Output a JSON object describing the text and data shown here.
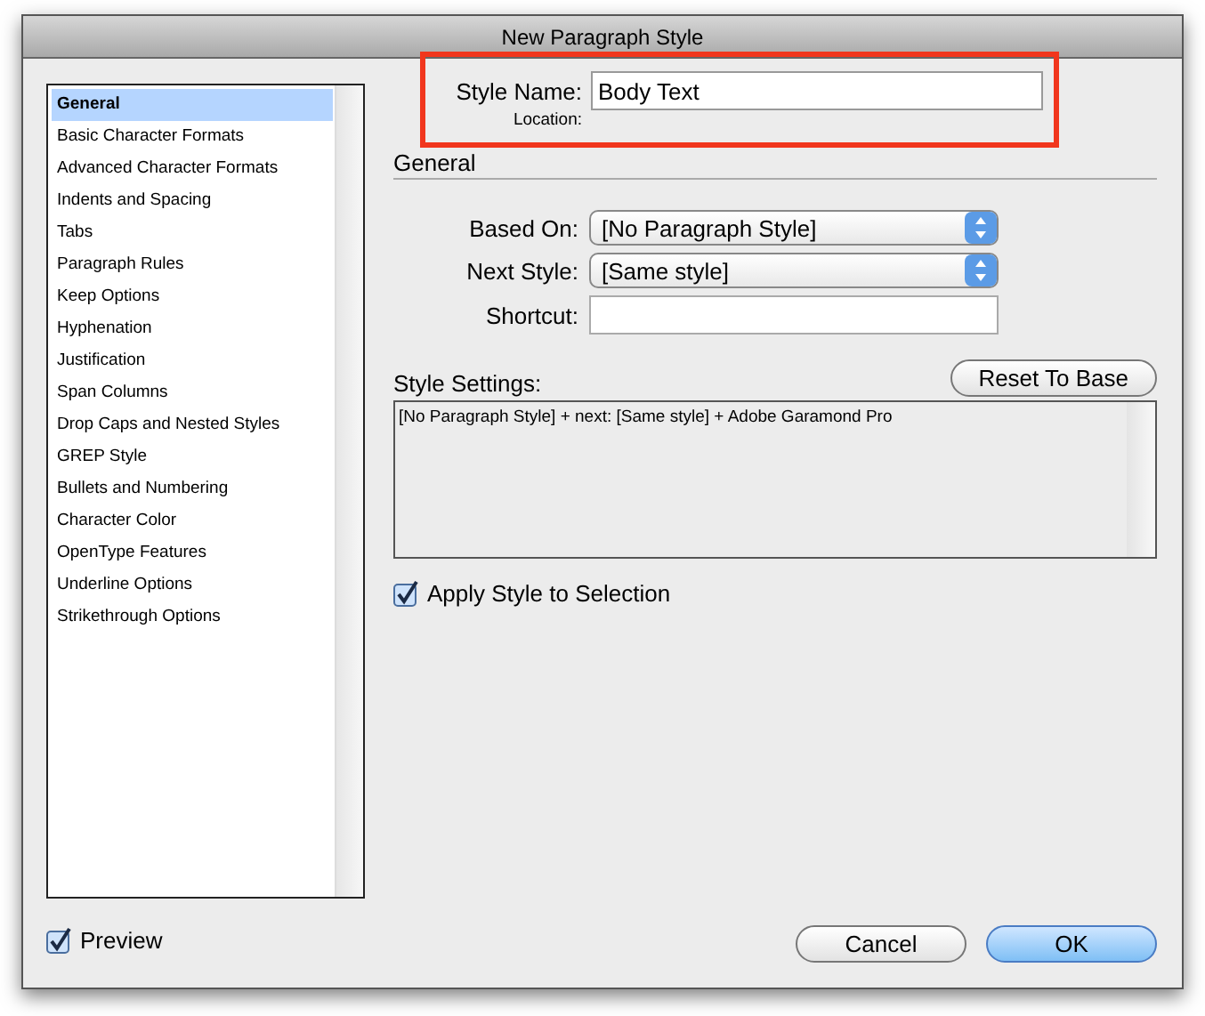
{
  "window": {
    "title": "New Paragraph Style"
  },
  "categories": [
    {
      "label": "General",
      "selected": true
    },
    {
      "label": "Basic Character Formats",
      "selected": false
    },
    {
      "label": "Advanced Character Formats",
      "selected": false
    },
    {
      "label": "Indents and Spacing",
      "selected": false
    },
    {
      "label": "Tabs",
      "selected": false
    },
    {
      "label": "Paragraph Rules",
      "selected": false
    },
    {
      "label": "Keep Options",
      "selected": false
    },
    {
      "label": "Hyphenation",
      "selected": false
    },
    {
      "label": "Justification",
      "selected": false
    },
    {
      "label": "Span Columns",
      "selected": false
    },
    {
      "label": "Drop Caps and Nested Styles",
      "selected": false
    },
    {
      "label": "GREP Style",
      "selected": false
    },
    {
      "label": "Bullets and Numbering",
      "selected": false
    },
    {
      "label": "Character Color",
      "selected": false
    },
    {
      "label": "OpenType Features",
      "selected": false
    },
    {
      "label": "Underline Options",
      "selected": false
    },
    {
      "label": "Strikethrough Options",
      "selected": false
    }
  ],
  "style_name": {
    "label": "Style Name:",
    "value": "Body Text"
  },
  "location": {
    "label": "Location:"
  },
  "section_title": "General",
  "based_on": {
    "label": "Based On:",
    "value": "[No Paragraph Style]"
  },
  "next_style": {
    "label": "Next Style:",
    "value": "[Same style]"
  },
  "shortcut": {
    "label": "Shortcut:"
  },
  "reset_button": "Reset To Base",
  "style_settings": {
    "label": "Style Settings:",
    "text": "[No Paragraph Style] + next: [Same style] + Adobe Garamond Pro"
  },
  "apply_style": {
    "label": "Apply Style to Selection",
    "checked": true
  },
  "preview": {
    "label": "Preview",
    "checked": true
  },
  "buttons": [
    {
      "label": "Cancel",
      "default": false
    },
    {
      "label": "OK",
      "default": true
    }
  ]
}
